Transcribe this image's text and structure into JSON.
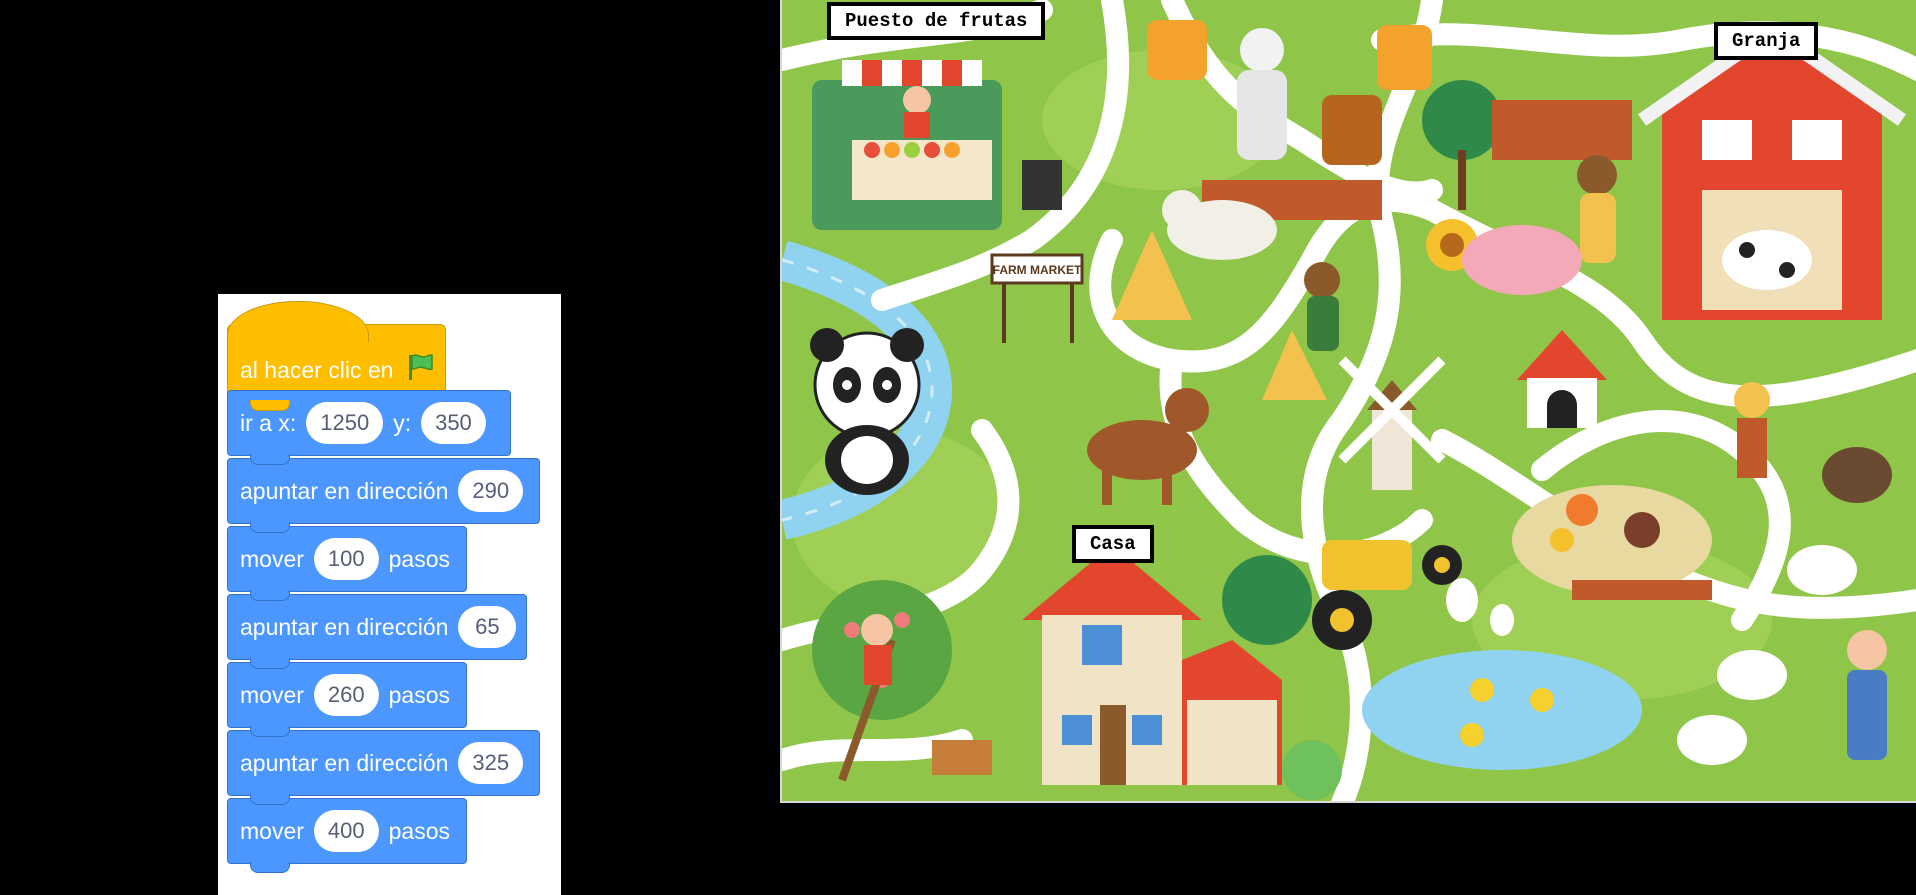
{
  "code": {
    "hat": {
      "label": "al hacer clic en",
      "icon": "green-flag-icon"
    },
    "goto": {
      "label_x": "ir a x:",
      "x": "1250",
      "label_y": "y:",
      "y": "350"
    },
    "blocks": [
      {
        "label": "apuntar en dirección",
        "value": "290"
      },
      {
        "label": "mover",
        "value": "100",
        "suffix": "pasos"
      },
      {
        "label": "apuntar en dirección",
        "value": "65"
      },
      {
        "label": "mover",
        "value": "260",
        "suffix": "pasos"
      },
      {
        "label": "apuntar en dirección",
        "value": "325"
      },
      {
        "label": "mover",
        "value": "400",
        "suffix": "pasos"
      }
    ],
    "colors": {
      "events": "#ffbf00",
      "motion": "#4c97ff"
    }
  },
  "map": {
    "labels": {
      "fruit_stand": "Puesto de frutas",
      "farm": "Granja",
      "house": "Casa",
      "market_sign": "FARM MARKET"
    },
    "colors": {
      "grass": "#8fc549",
      "path": "#ffffff",
      "river": "#8fd3f0",
      "barn": "#e2462c"
    }
  }
}
